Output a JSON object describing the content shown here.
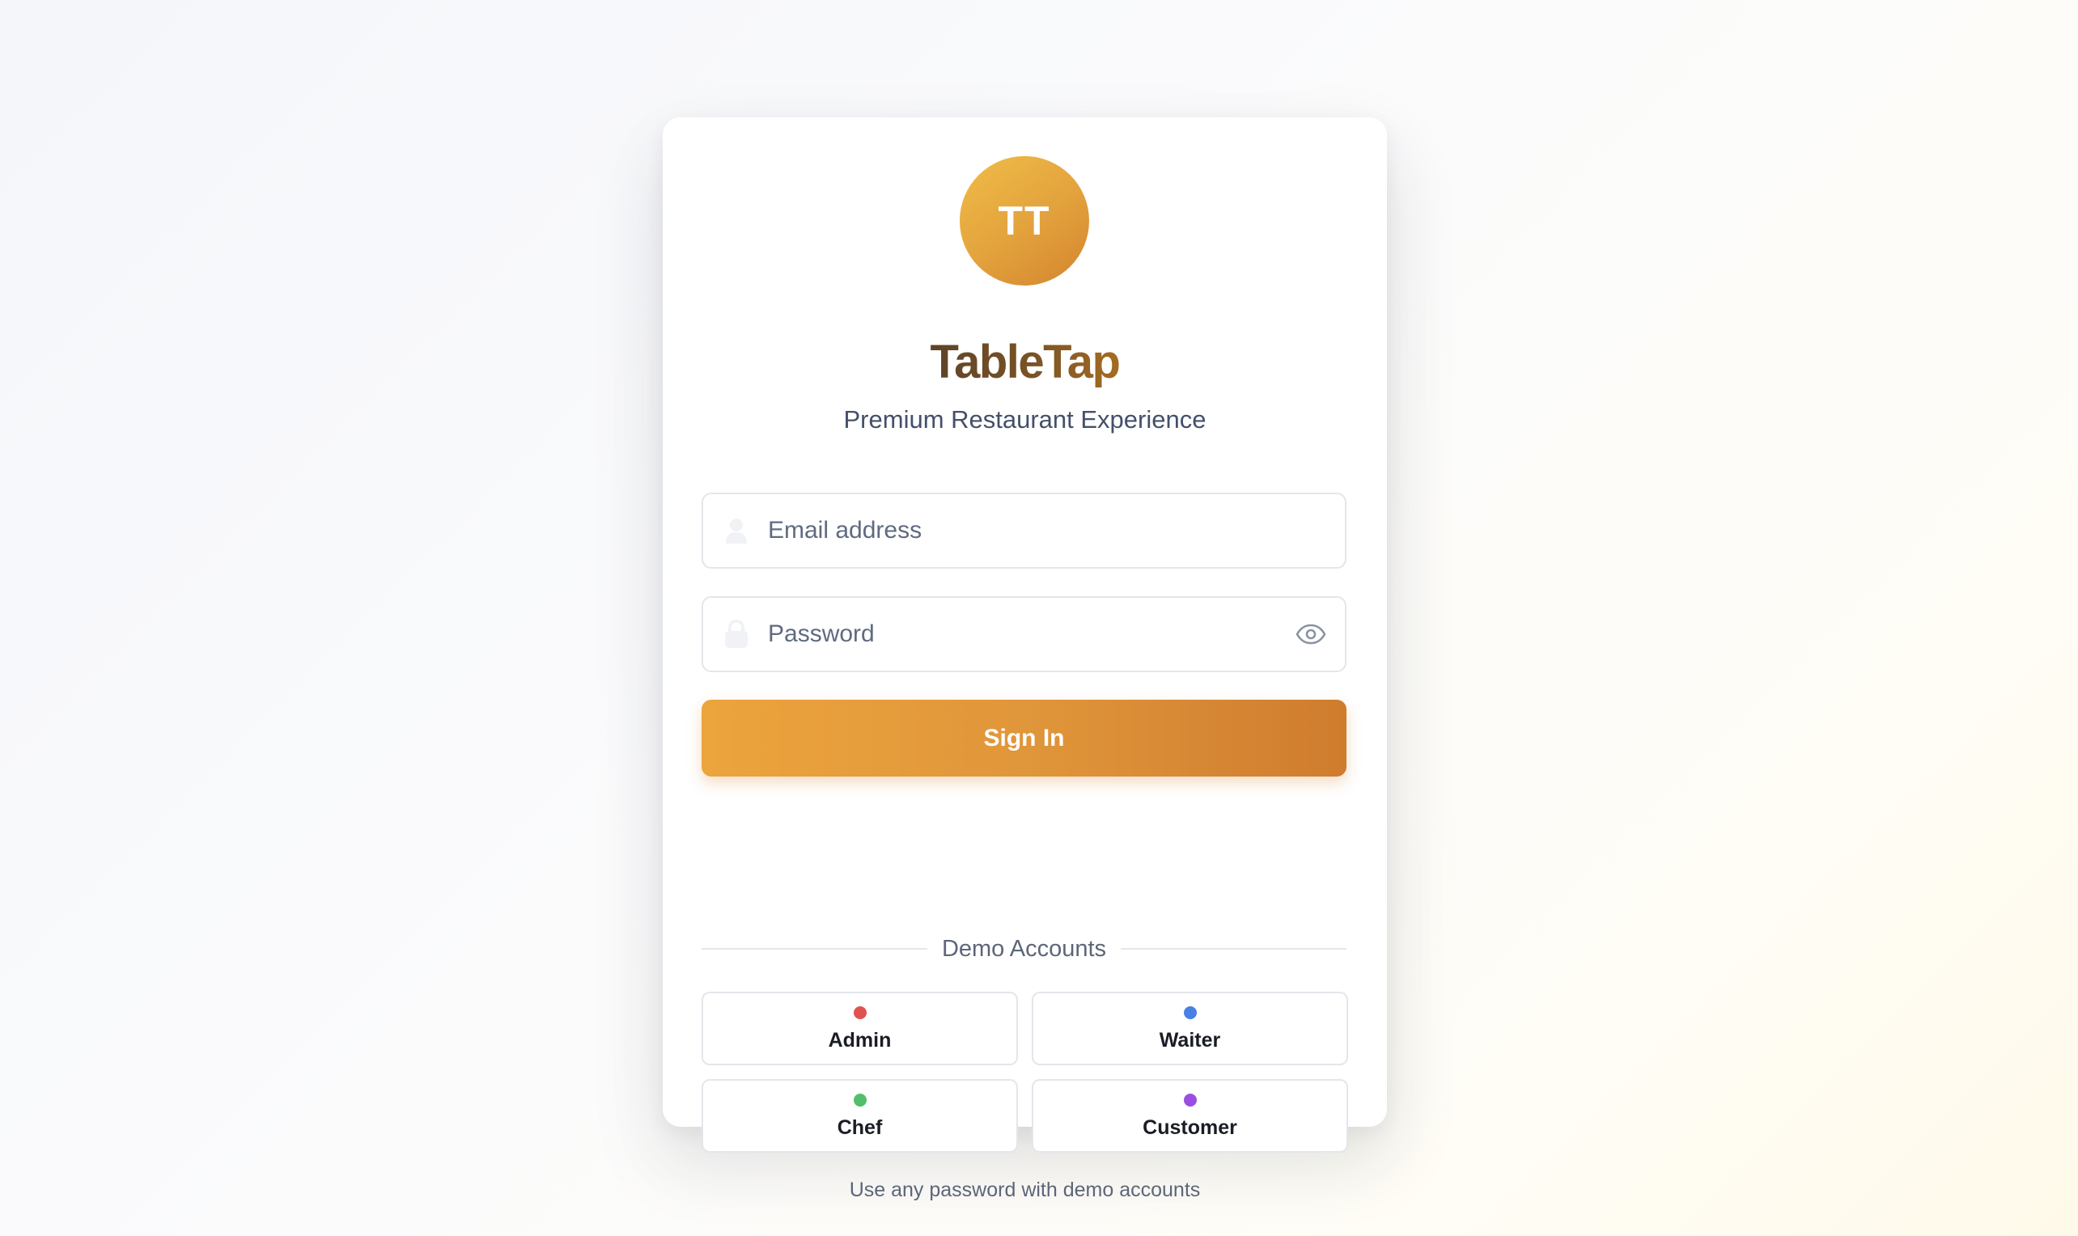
{
  "brand": {
    "initials": "TT",
    "name": "TableTap",
    "tagline": "Premium Restaurant Experience",
    "logo_gradient": [
      "#f0bd48",
      "#d4842f"
    ]
  },
  "form": {
    "email": {
      "placeholder": "Email address",
      "value": "",
      "icon": "user-icon"
    },
    "password": {
      "placeholder": "Password",
      "value": "",
      "icon": "lock-icon",
      "toggle_icon": "eye-icon"
    },
    "submit_label": "Sign In",
    "submit_color": "#e0963a"
  },
  "demo": {
    "heading": "Demo Accounts",
    "accounts": [
      {
        "label": "Admin",
        "color": "#e05252"
      },
      {
        "label": "Waiter",
        "color": "#4a7fe6"
      },
      {
        "label": "Chef",
        "color": "#52bf6a"
      },
      {
        "label": "Customer",
        "color": "#9b4fe0"
      }
    ],
    "hint": "Use any password with demo accounts"
  }
}
